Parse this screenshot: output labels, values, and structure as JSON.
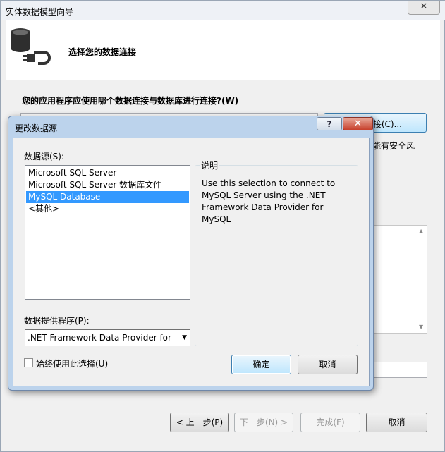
{
  "wizard": {
    "title": "实体数据模型向导",
    "close_glyph": "✕",
    "header_title": "选择您的数据连接",
    "question": "您的应用程序应使用哪个数据连接与数据库进行连接?(W)",
    "new_connection_label": "接(C)...",
    "side_text": "能有安全风",
    "buttons": {
      "prev": "< 上一步(P)",
      "next": "下一步(N) >",
      "finish": "完成(F)",
      "cancel": "取消"
    }
  },
  "dialog": {
    "title": "更改数据源",
    "help_glyph": "?",
    "close_glyph": "✕",
    "datasource_label": "数据源(S):",
    "datasources": [
      "Microsoft SQL Server",
      "Microsoft SQL Server 数据库文件",
      "MySQL Database",
      "<其他>"
    ],
    "selected_index": 2,
    "provider_label": "数据提供程序(P):",
    "provider_value": ".NET Framework Data Provider for MySQL",
    "description_legend": "说明",
    "description_text": "Use this selection to connect to MySQL Server using the .NET Framework Data Provider for MySQL",
    "always_use_label": "始终使用此选择(U)",
    "always_use_checked": false,
    "ok_label": "确定",
    "cancel_label": "取消"
  }
}
